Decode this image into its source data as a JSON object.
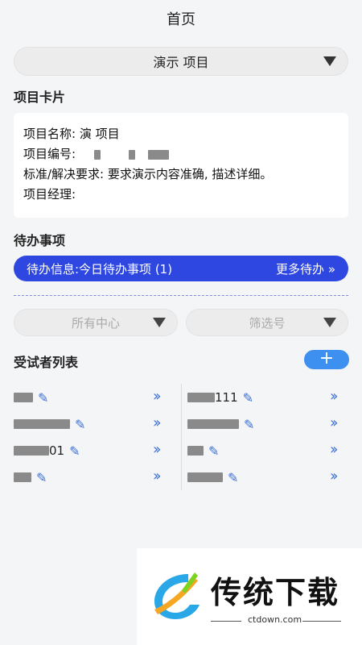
{
  "header": {
    "title": "首页"
  },
  "project_select": {
    "value": "演示  项目"
  },
  "project_card": {
    "section_title": "项目卡片",
    "name_label": "项目名称:",
    "name_value": "演  项目",
    "code_label": "项目编号:",
    "code_value": "",
    "standard_label": "标准/解决要求:",
    "standard_value": "要求演示内容准确, 描述详细。",
    "manager_label": "项目经理:",
    "manager_value": ""
  },
  "todo": {
    "section_title": "待办事项",
    "info": "待办信息:今日待办事项 (1)",
    "more": "更多待办"
  },
  "filters": {
    "center_placeholder": "所有中心",
    "screening_placeholder": "筛选号"
  },
  "subjects": {
    "section_title": "受试者列表",
    "add_label": "+",
    "left": [
      {
        "text": ""
      },
      {
        "text": ""
      },
      {
        "text": "01"
      },
      {
        "text": ""
      }
    ],
    "right": [
      {
        "text": "111"
      },
      {
        "text": ""
      },
      {
        "text": ""
      },
      {
        "text": ""
      }
    ]
  },
  "watermark": {
    "brand": "传统下载",
    "site": "ctdown.com"
  }
}
